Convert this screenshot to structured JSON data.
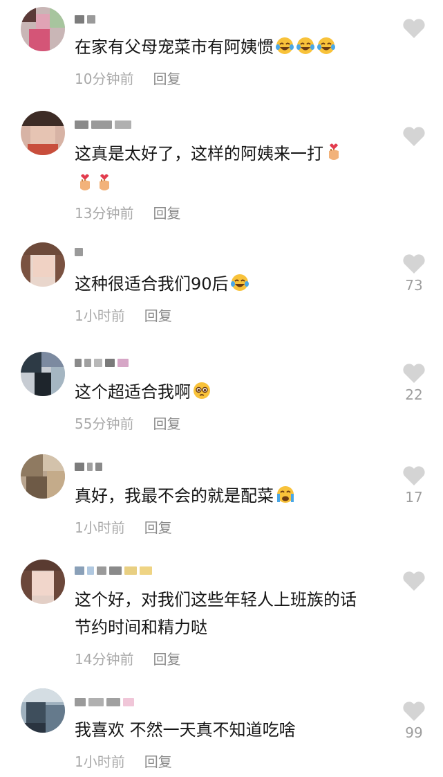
{
  "comments": [
    {
      "text": "在家有父母宠菜市有阿姨惯",
      "time": "10分钟前",
      "reply": "回复",
      "likes": "",
      "emoji": [
        "laugh-cry",
        "laugh-cry",
        "laugh-cry"
      ]
    },
    {
      "text": "这真是太好了，这样的阿姨来一打",
      "time": "13分钟前",
      "reply": "回复",
      "likes": "",
      "emoji": [
        "finger-heart",
        "finger-heart",
        "finger-heart"
      ]
    },
    {
      "text": "这种很适合我们90后",
      "time": "1小时前",
      "reply": "回复",
      "likes": "73",
      "emoji": [
        "laugh-cry"
      ]
    },
    {
      "text": "这个超适合我啊",
      "time": "55分钟前",
      "reply": "回复",
      "likes": "22",
      "emoji": [
        "pleading-face"
      ]
    },
    {
      "text": "真好，我最不会的就是配菜",
      "time": "1小时前",
      "reply": "回复",
      "likes": "17",
      "emoji": [
        "crying-face"
      ]
    },
    {
      "text": "这个好，对我们这些年轻人上班族的话节约时间和精力哒",
      "time": "14分钟前",
      "reply": "回复",
      "likes": "",
      "emoji": []
    },
    {
      "text": "我喜欢 不然一天真不知道吃啥",
      "time": "1小时前",
      "reply": "回复",
      "likes": "99",
      "emoji": []
    }
  ],
  "colors": {
    "text": "#161616",
    "meta": "#a9a9a9",
    "heart": "#d4d4d4"
  }
}
